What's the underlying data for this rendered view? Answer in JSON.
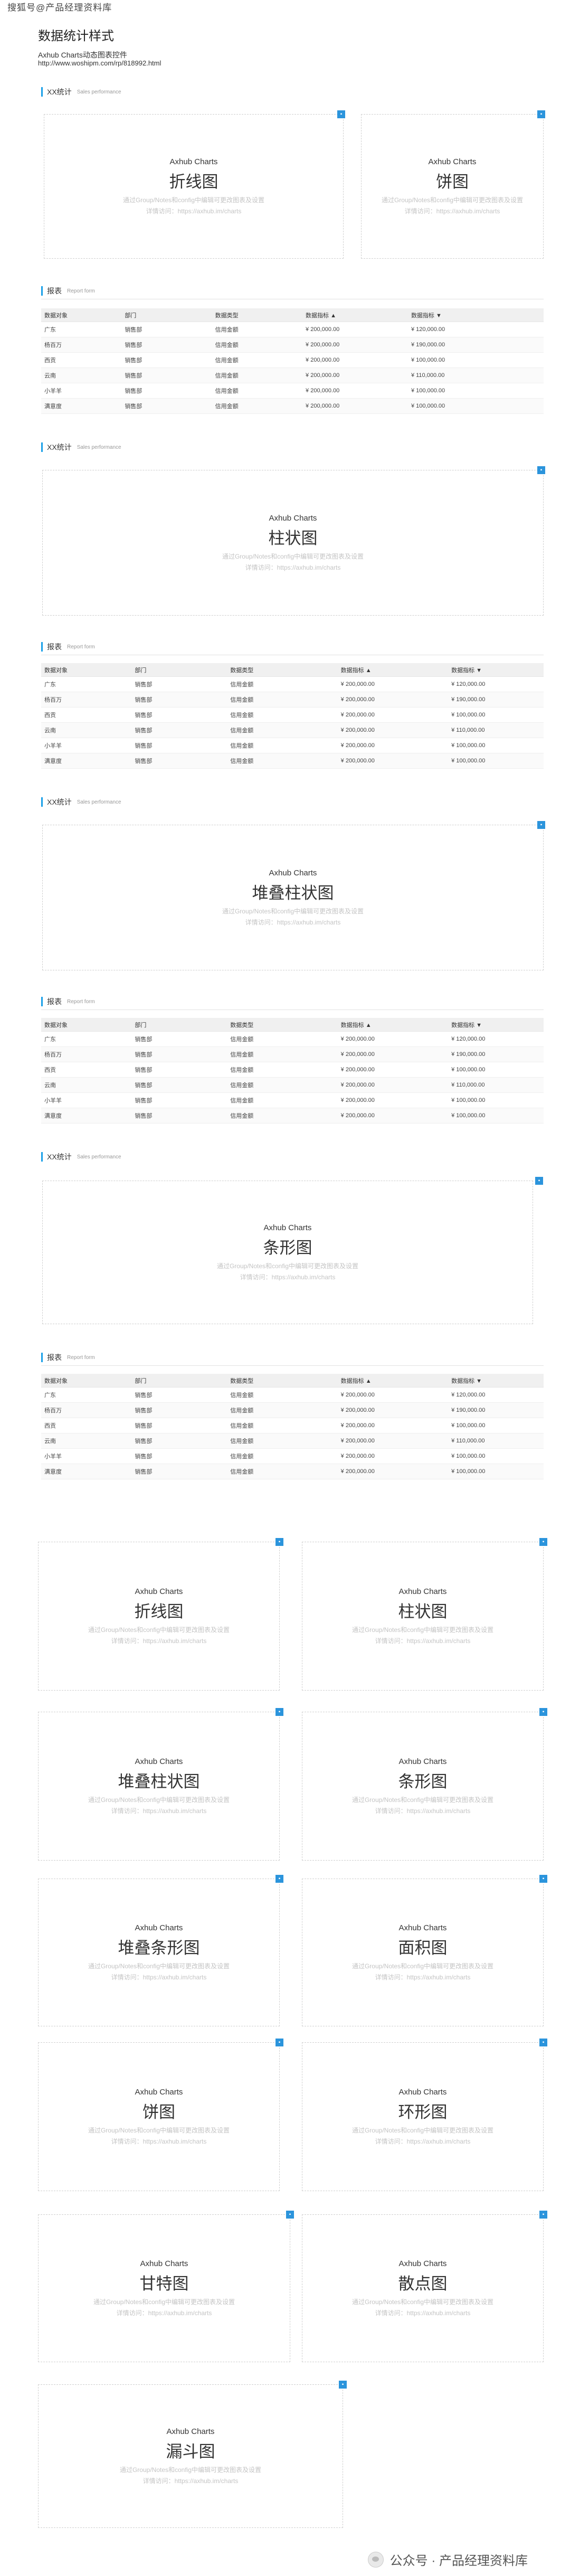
{
  "watermark_top": "搜狐号@产品经理资料库",
  "page_title": "数据统计样式",
  "subtitle": "Axhub Charts动态图表控件",
  "url": "http://www.woshipm.com/rp/818992.html",
  "chart_axhub": "Axhub Charts",
  "chart_note1": "通过Group/Notes和config中编辑可更改图表及设置",
  "chart_note2": "详情访问：https://axhub.im/charts",
  "sections": {
    "stats_title": "XX统计",
    "stats_en": "Sales performance",
    "report_title": "报表",
    "report_en": "Report form"
  },
  "charts": {
    "c1": "折线图",
    "c2": "饼图",
    "c3": "柱状图",
    "c4": "堆叠柱状图",
    "c5": "条形图",
    "g1": "折线图",
    "g2": "柱状图",
    "g3": "堆叠柱状图",
    "g4": "条形图",
    "g5": "堆叠条形图",
    "g6": "面积图",
    "g7": "饼图",
    "g8": "环形图",
    "g9": "甘特图",
    "g10": "散点图",
    "g11": "漏斗图"
  },
  "table": {
    "headers": [
      "数据对象",
      "部门",
      "数据类型",
      "数据指标 ▲",
      "数据指标 ▼"
    ],
    "rows": [
      [
        "广东",
        "销售部",
        "信用金额",
        "¥ 200,000.00",
        "¥ 120,000.00"
      ],
      [
        "杨百万",
        "销售部",
        "信用金额",
        "¥ 200,000.00",
        "¥ 190,000.00"
      ],
      [
        "西贡",
        "销售部",
        "信用金额",
        "¥ 200,000.00",
        "¥ 100,000.00"
      ],
      [
        "云南",
        "销售部",
        "信用金额",
        "¥ 200,000.00",
        "¥ 110,000.00"
      ],
      [
        "小羊羊",
        "销售部",
        "信用金额",
        "¥ 200,000.00",
        "¥ 100,000.00"
      ],
      [
        "满意度",
        "销售部",
        "信用金额",
        "¥ 200,000.00",
        "¥ 100,000.00"
      ]
    ]
  },
  "footer_watermark": "公众号 · 产品经理资料库"
}
